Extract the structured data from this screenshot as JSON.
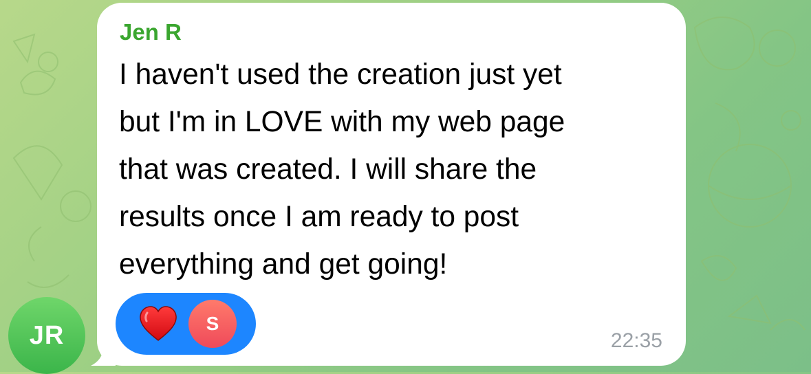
{
  "message": {
    "sender_name": "Jen R",
    "text": "I haven't used the creation just yet\nbut I'm in LOVE with my web page\nthat was created.  I will share the\nresults once I am ready to post\neverything and get going!",
    "time": "22:35"
  },
  "avatar": {
    "initials": "JR"
  },
  "reactions": {
    "emoji_icon": "heart-icon",
    "reactor_initial": "S"
  },
  "colors": {
    "sender_name": "#3aa62f",
    "reaction_pill": "#1d86ff",
    "avatar_green": "#3bb54a",
    "reactor_red": "#ef4a5a",
    "heart": "#e8151b"
  }
}
